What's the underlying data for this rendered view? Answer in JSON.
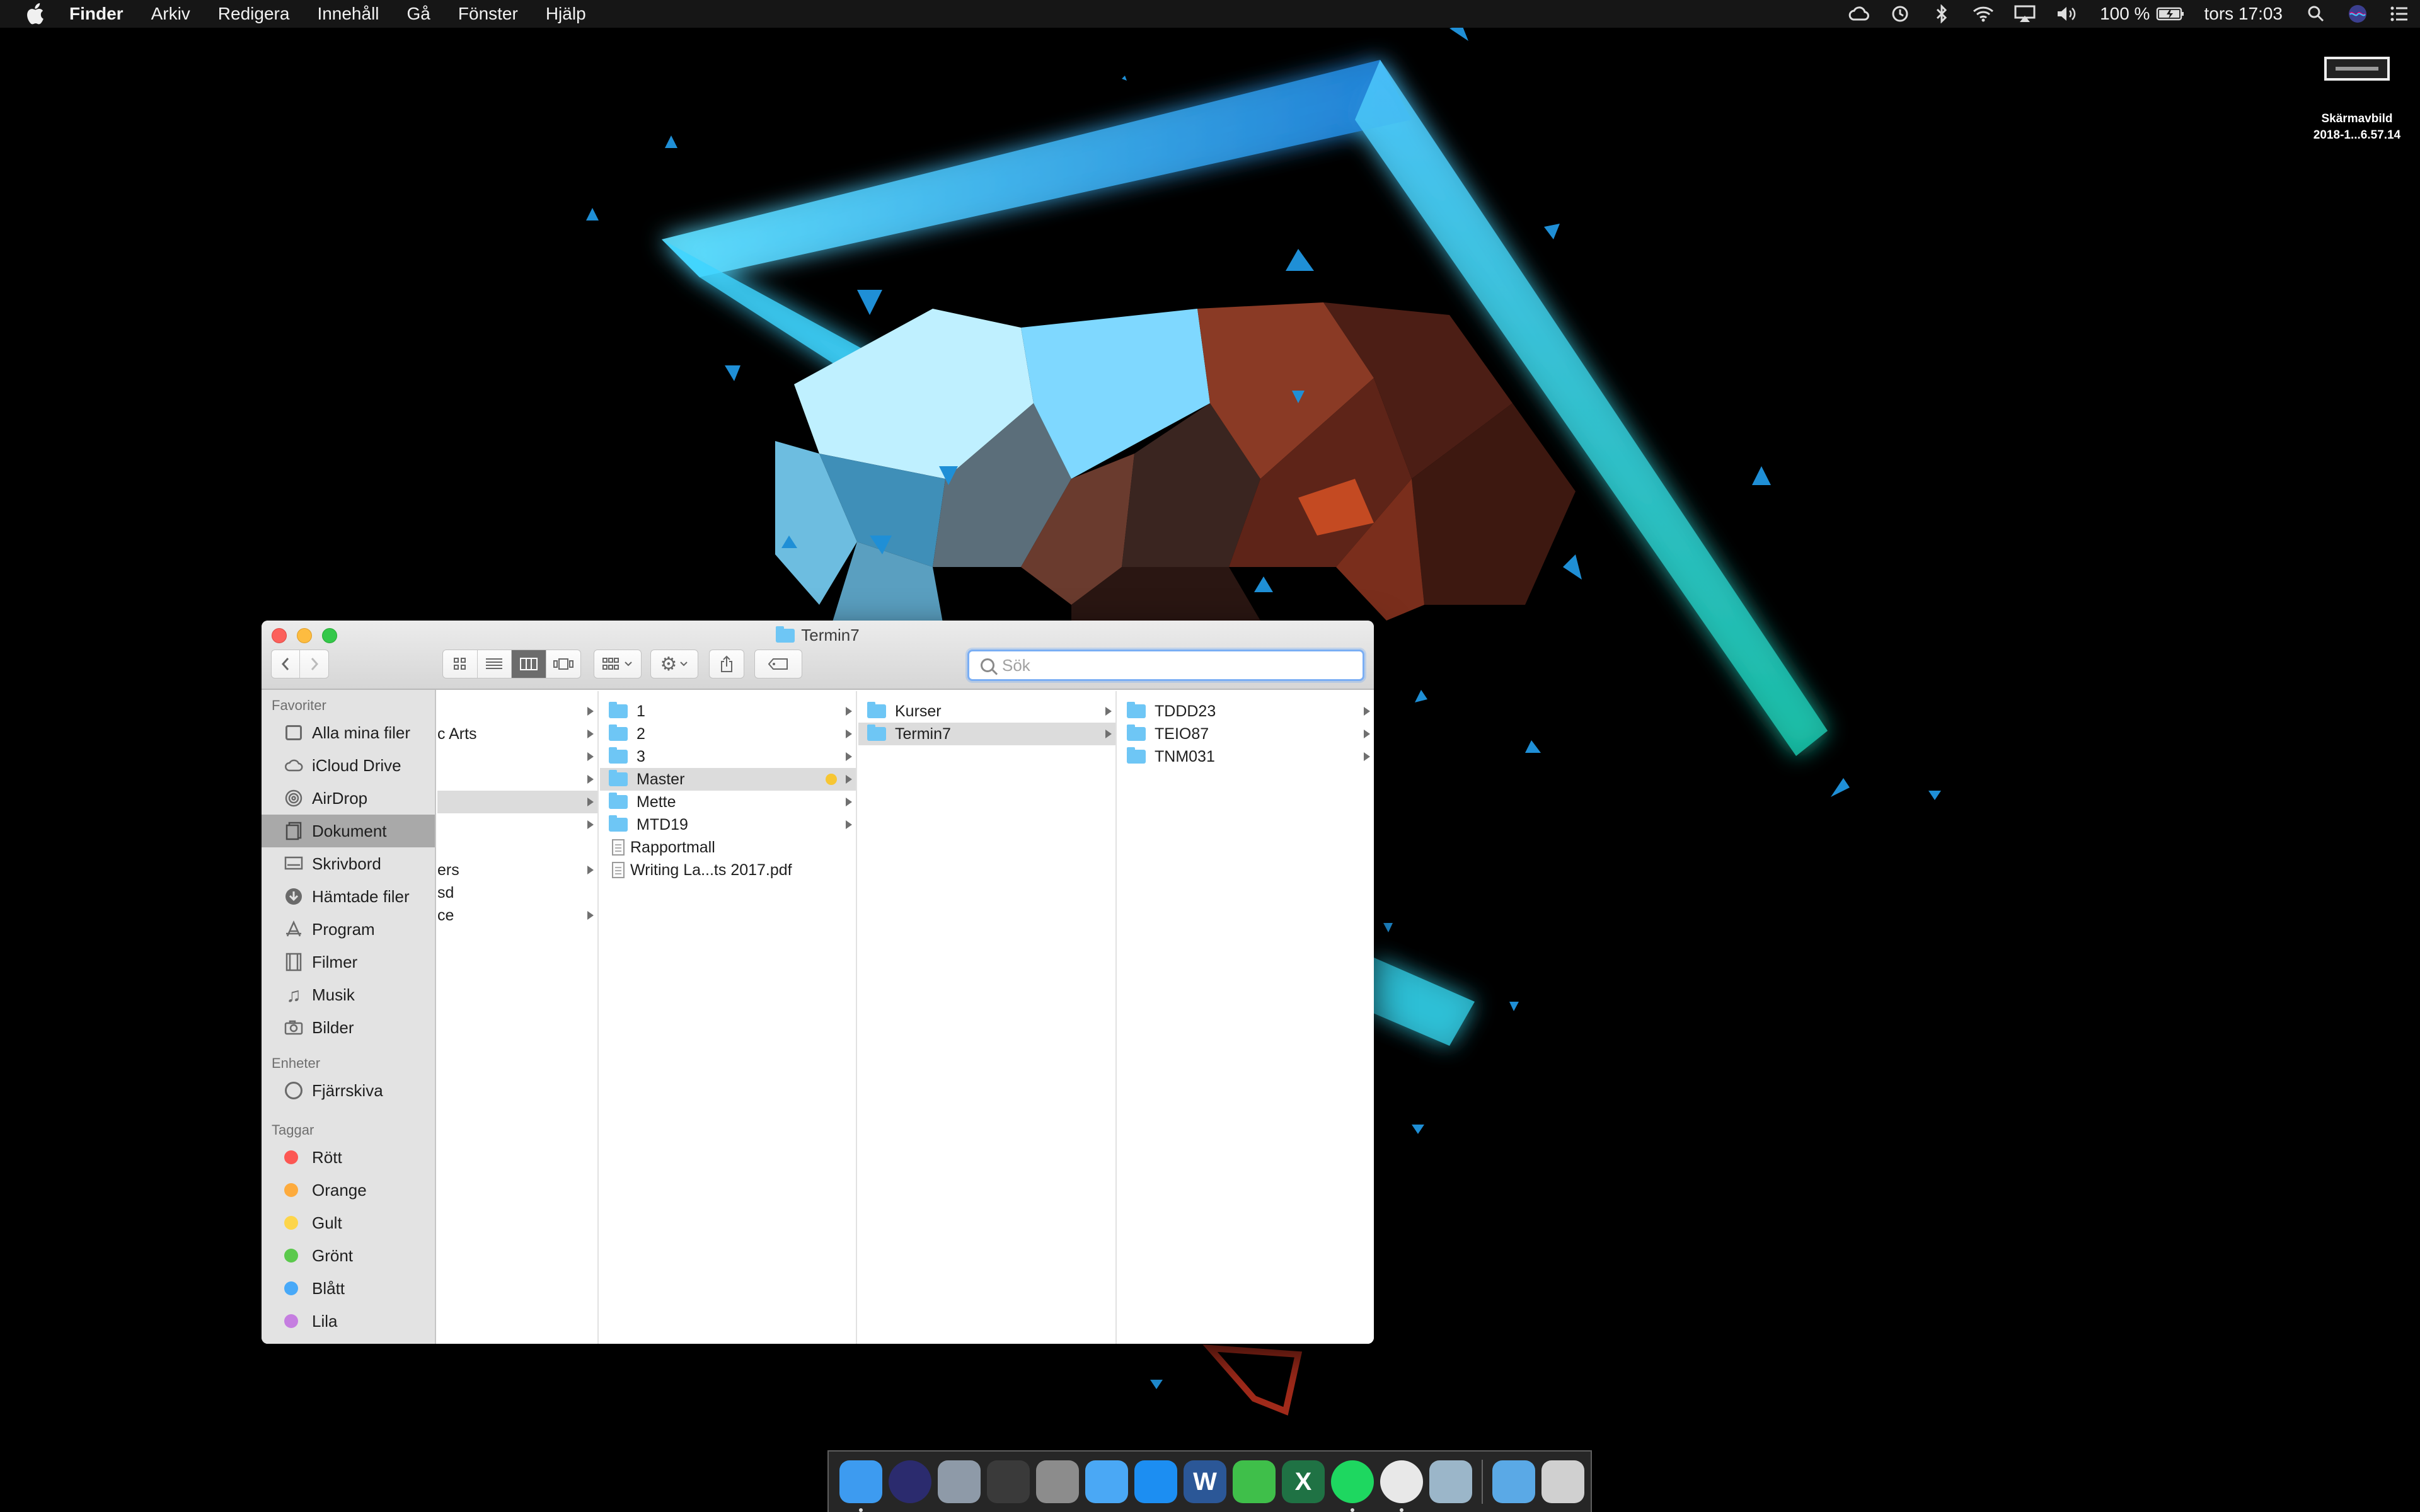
{
  "menubar": {
    "app_name": "Finder",
    "menus": [
      "Arkiv",
      "Redigera",
      "Innehåll",
      "Gå",
      "Fönster",
      "Hjälp"
    ],
    "battery_percent": "100 %",
    "clock": "tors 17:03",
    "status_icons": [
      "creative-cloud-icon",
      "time-machine-icon",
      "bluetooth-icon",
      "wifi-icon",
      "airplay-icon",
      "volume-icon",
      "battery-icon",
      "spotlight-icon",
      "siri-icon",
      "notification-center-icon"
    ]
  },
  "desktop": {
    "file_name_line1": "Skärmavbild",
    "file_name_line2": "2018-1...6.57.14"
  },
  "finder": {
    "title": "Termin7",
    "search_placeholder": "Sök",
    "sidebar": {
      "favorites_heading": "Favoriter",
      "favorites": [
        {
          "label": "Alla mina filer",
          "icon": "all-files-icon"
        },
        {
          "label": "iCloud Drive",
          "icon": "icloud-icon"
        },
        {
          "label": "AirDrop",
          "icon": "airdrop-icon"
        },
        {
          "label": "Dokument",
          "icon": "documents-icon",
          "selected": true
        },
        {
          "label": "Skrivbord",
          "icon": "desktop-icon"
        },
        {
          "label": "Hämtade filer",
          "icon": "downloads-icon"
        },
        {
          "label": "Program",
          "icon": "applications-icon"
        },
        {
          "label": "Filmer",
          "icon": "movies-icon"
        },
        {
          "label": "Musik",
          "icon": "music-icon"
        },
        {
          "label": "Bilder",
          "icon": "pictures-icon"
        }
      ],
      "devices_heading": "Enheter",
      "devices": [
        {
          "label": "Fjärrskiva",
          "icon": "remote-disc-icon"
        }
      ],
      "tags_heading": "Taggar",
      "tags": [
        {
          "label": "Rött",
          "color": "#fc5753"
        },
        {
          "label": "Orange",
          "color": "#fdab3d"
        },
        {
          "label": "Gult",
          "color": "#fdd54a"
        },
        {
          "label": "Grönt",
          "color": "#5bc94c"
        },
        {
          "label": "Blått",
          "color": "#48a9f8"
        },
        {
          "label": "Lila",
          "color": "#c57ee0"
        }
      ]
    },
    "column1": {
      "rows": [
        {
          "label": "",
          "arrow": true
        },
        {
          "label": "c Arts",
          "arrow": true
        },
        {
          "label": "",
          "arrow": true
        },
        {
          "label": "",
          "arrow": true
        },
        {
          "label": "",
          "arrow": true,
          "selected": true
        },
        {
          "label": "",
          "arrow": true
        },
        {
          "label": "",
          "arrow": false
        },
        {
          "label": "ers",
          "arrow": true
        },
        {
          "label": "sd",
          "arrow": false
        },
        {
          "label": "ce",
          "arrow": true
        }
      ]
    },
    "column2": {
      "rows": [
        {
          "label": "1",
          "type": "folder",
          "arrow": true
        },
        {
          "label": "2",
          "type": "folder",
          "arrow": true
        },
        {
          "label": "3",
          "type": "folder",
          "arrow": true
        },
        {
          "label": "Master",
          "type": "folder",
          "arrow": true,
          "selected": true,
          "tag": "#f7c633"
        },
        {
          "label": "Mette",
          "type": "folder",
          "arrow": true
        },
        {
          "label": "MTD19",
          "type": "folder",
          "arrow": true
        },
        {
          "label": "Rapportmall",
          "type": "document",
          "arrow": false
        },
        {
          "label": "Writing La...ts 2017.pdf",
          "type": "document",
          "arrow": false
        }
      ]
    },
    "column3": {
      "rows": [
        {
          "label": "Kurser",
          "type": "folder",
          "arrow": true
        },
        {
          "label": "Termin7",
          "type": "folder",
          "arrow": true,
          "selected": true
        }
      ]
    },
    "column4": {
      "rows": [
        {
          "label": "TDDD23",
          "type": "folder",
          "arrow": true
        },
        {
          "label": "TEIO87",
          "type": "folder",
          "arrow": true
        },
        {
          "label": "TNM031",
          "type": "folder",
          "arrow": true
        }
      ]
    }
  },
  "dock": {
    "apps": [
      {
        "name": "finder-icon",
        "color": "#3d9bf0",
        "glyph": "",
        "running": true
      },
      {
        "name": "siri-icon",
        "color": "#2b2b6e",
        "glyph": "",
        "running": false
      },
      {
        "name": "launchpad-icon",
        "color": "#8e9aa8",
        "glyph": "",
        "running": false
      },
      {
        "name": "mission-control-icon",
        "color": "#3a3a3a",
        "glyph": "",
        "running": false
      },
      {
        "name": "system-preferences-icon",
        "color": "#8c8c8c",
        "glyph": "",
        "running": false
      },
      {
        "name": "messages-icon",
        "color": "#4aa8f5",
        "glyph": "",
        "running": false
      },
      {
        "name": "app-store-icon",
        "color": "#1c8ef2",
        "glyph": "",
        "running": false
      },
      {
        "name": "word-icon",
        "color": "#2b5797",
        "glyph": "W",
        "running": false
      },
      {
        "name": "facetime-icon",
        "color": "#3fbf4a",
        "glyph": "",
        "running": false
      },
      {
        "name": "excel-icon",
        "color": "#1f7244",
        "glyph": "X",
        "running": false
      },
      {
        "name": "spotify-icon",
        "color": "#1ed760",
        "glyph": "",
        "running": true
      },
      {
        "name": "chrome-icon",
        "color": "#e8e8e8",
        "glyph": "",
        "running": true
      },
      {
        "name": "preview-icon",
        "color": "#9bb6c9",
        "glyph": "",
        "running": false
      },
      {
        "name": "downloads-folder-icon",
        "color": "#5aa9e6",
        "glyph": "",
        "running": false
      },
      {
        "name": "trash-icon",
        "color": "#d0d0d0",
        "glyph": "",
        "running": false
      }
    ]
  }
}
